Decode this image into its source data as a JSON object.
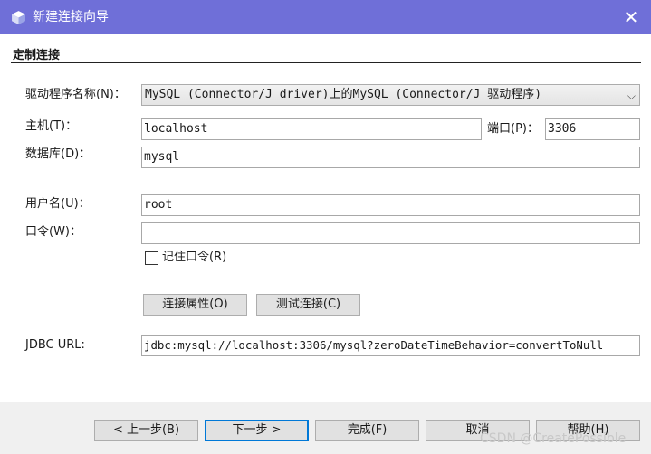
{
  "window": {
    "title": "新建连接向导",
    "close_glyph": "✕"
  },
  "section": {
    "title": "定制连接"
  },
  "form": {
    "driver_label": "驱动程序名称(N)：",
    "driver_value": "MySQL (Connector/J driver)上的MySQL (Connector/J 驱动程序)",
    "driver_arrow": "⌵",
    "host_label": "主机(T)：",
    "host_value": "localhost",
    "port_label": "端口(P)：",
    "port_value": "3306",
    "database_label": "数据库(D)：",
    "database_value": "mysql",
    "username_label": "用户名(U)：",
    "username_value": "root",
    "password_label": "口令(W)：",
    "password_value": "",
    "remember_label": "记住口令(R)",
    "remember_checked": false,
    "conn_props_label": "连接属性(O)",
    "test_conn_label": "测试连接(C)",
    "jdbc_label": "JDBC URL:",
    "jdbc_value": "jdbc:mysql://localhost:3306/mysql?zeroDateTimeBehavior=convertToNull"
  },
  "footer": {
    "back_label": "< 上一步(B)",
    "next_label": "下一步 >",
    "finish_label": "完成(F)",
    "cancel_label": "取消",
    "help_label": "帮助(H)"
  },
  "watermark": "CSDN @CreatePossible",
  "colors": {
    "titlebar": "#6f6fd8",
    "default_button_border": "#0078d7"
  },
  "icons": {
    "app": "cube-icon",
    "close": "close-icon",
    "dropdown": "chevron-down-icon"
  }
}
